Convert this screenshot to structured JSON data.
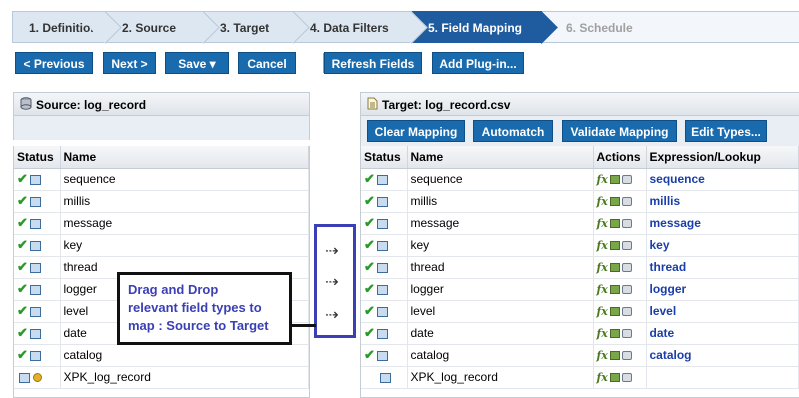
{
  "wizard": {
    "steps": [
      "1. Definition",
      "2. Source",
      "3. Target",
      "4. Data Filters",
      "5. Field Mapping",
      "6. Schedule"
    ]
  },
  "toolbar": {
    "previous": "< Previous",
    "next": "Next >",
    "save": "Save ▾",
    "cancel": "Cancel",
    "refresh": "Refresh Fields",
    "plugin": "Add Plug-in..."
  },
  "source": {
    "title": "Source: log_record",
    "col_status": "Status",
    "col_name": "Name",
    "rows": [
      "sequence",
      "millis",
      "message",
      "key",
      "thread",
      "logger",
      "level",
      "date",
      "catalog",
      "XPK_log_record"
    ]
  },
  "target": {
    "title": "Target: log_record.csv",
    "buttons": {
      "clear": "Clear Mapping",
      "automatch": "Automatch",
      "validate": "Validate Mapping",
      "edit_types": "Edit Types..."
    },
    "col_status": "Status",
    "col_name": "Name",
    "col_actions": "Actions",
    "col_expr": "Expression/Lookup",
    "rows": [
      {
        "name": "sequence",
        "expr": "sequence"
      },
      {
        "name": "millis",
        "expr": "millis"
      },
      {
        "name": "message",
        "expr": "message"
      },
      {
        "name": "key",
        "expr": "key"
      },
      {
        "name": "thread",
        "expr": "thread"
      },
      {
        "name": "logger",
        "expr": "logger"
      },
      {
        "name": "level",
        "expr": "level"
      },
      {
        "name": "date",
        "expr": "date"
      },
      {
        "name": "catalog",
        "expr": "catalog"
      },
      {
        "name": "XPK_log_record",
        "expr": ""
      }
    ]
  },
  "annotation": {
    "line1": "Drag and Drop",
    "line2": "relevant field types to",
    "line3": "map : Source to Target"
  },
  "colors": {
    "accent": "#1a6bae",
    "active_step": "#1f5b9f",
    "expression": "#1a3ea8",
    "annotation": "#3a3fb5"
  }
}
